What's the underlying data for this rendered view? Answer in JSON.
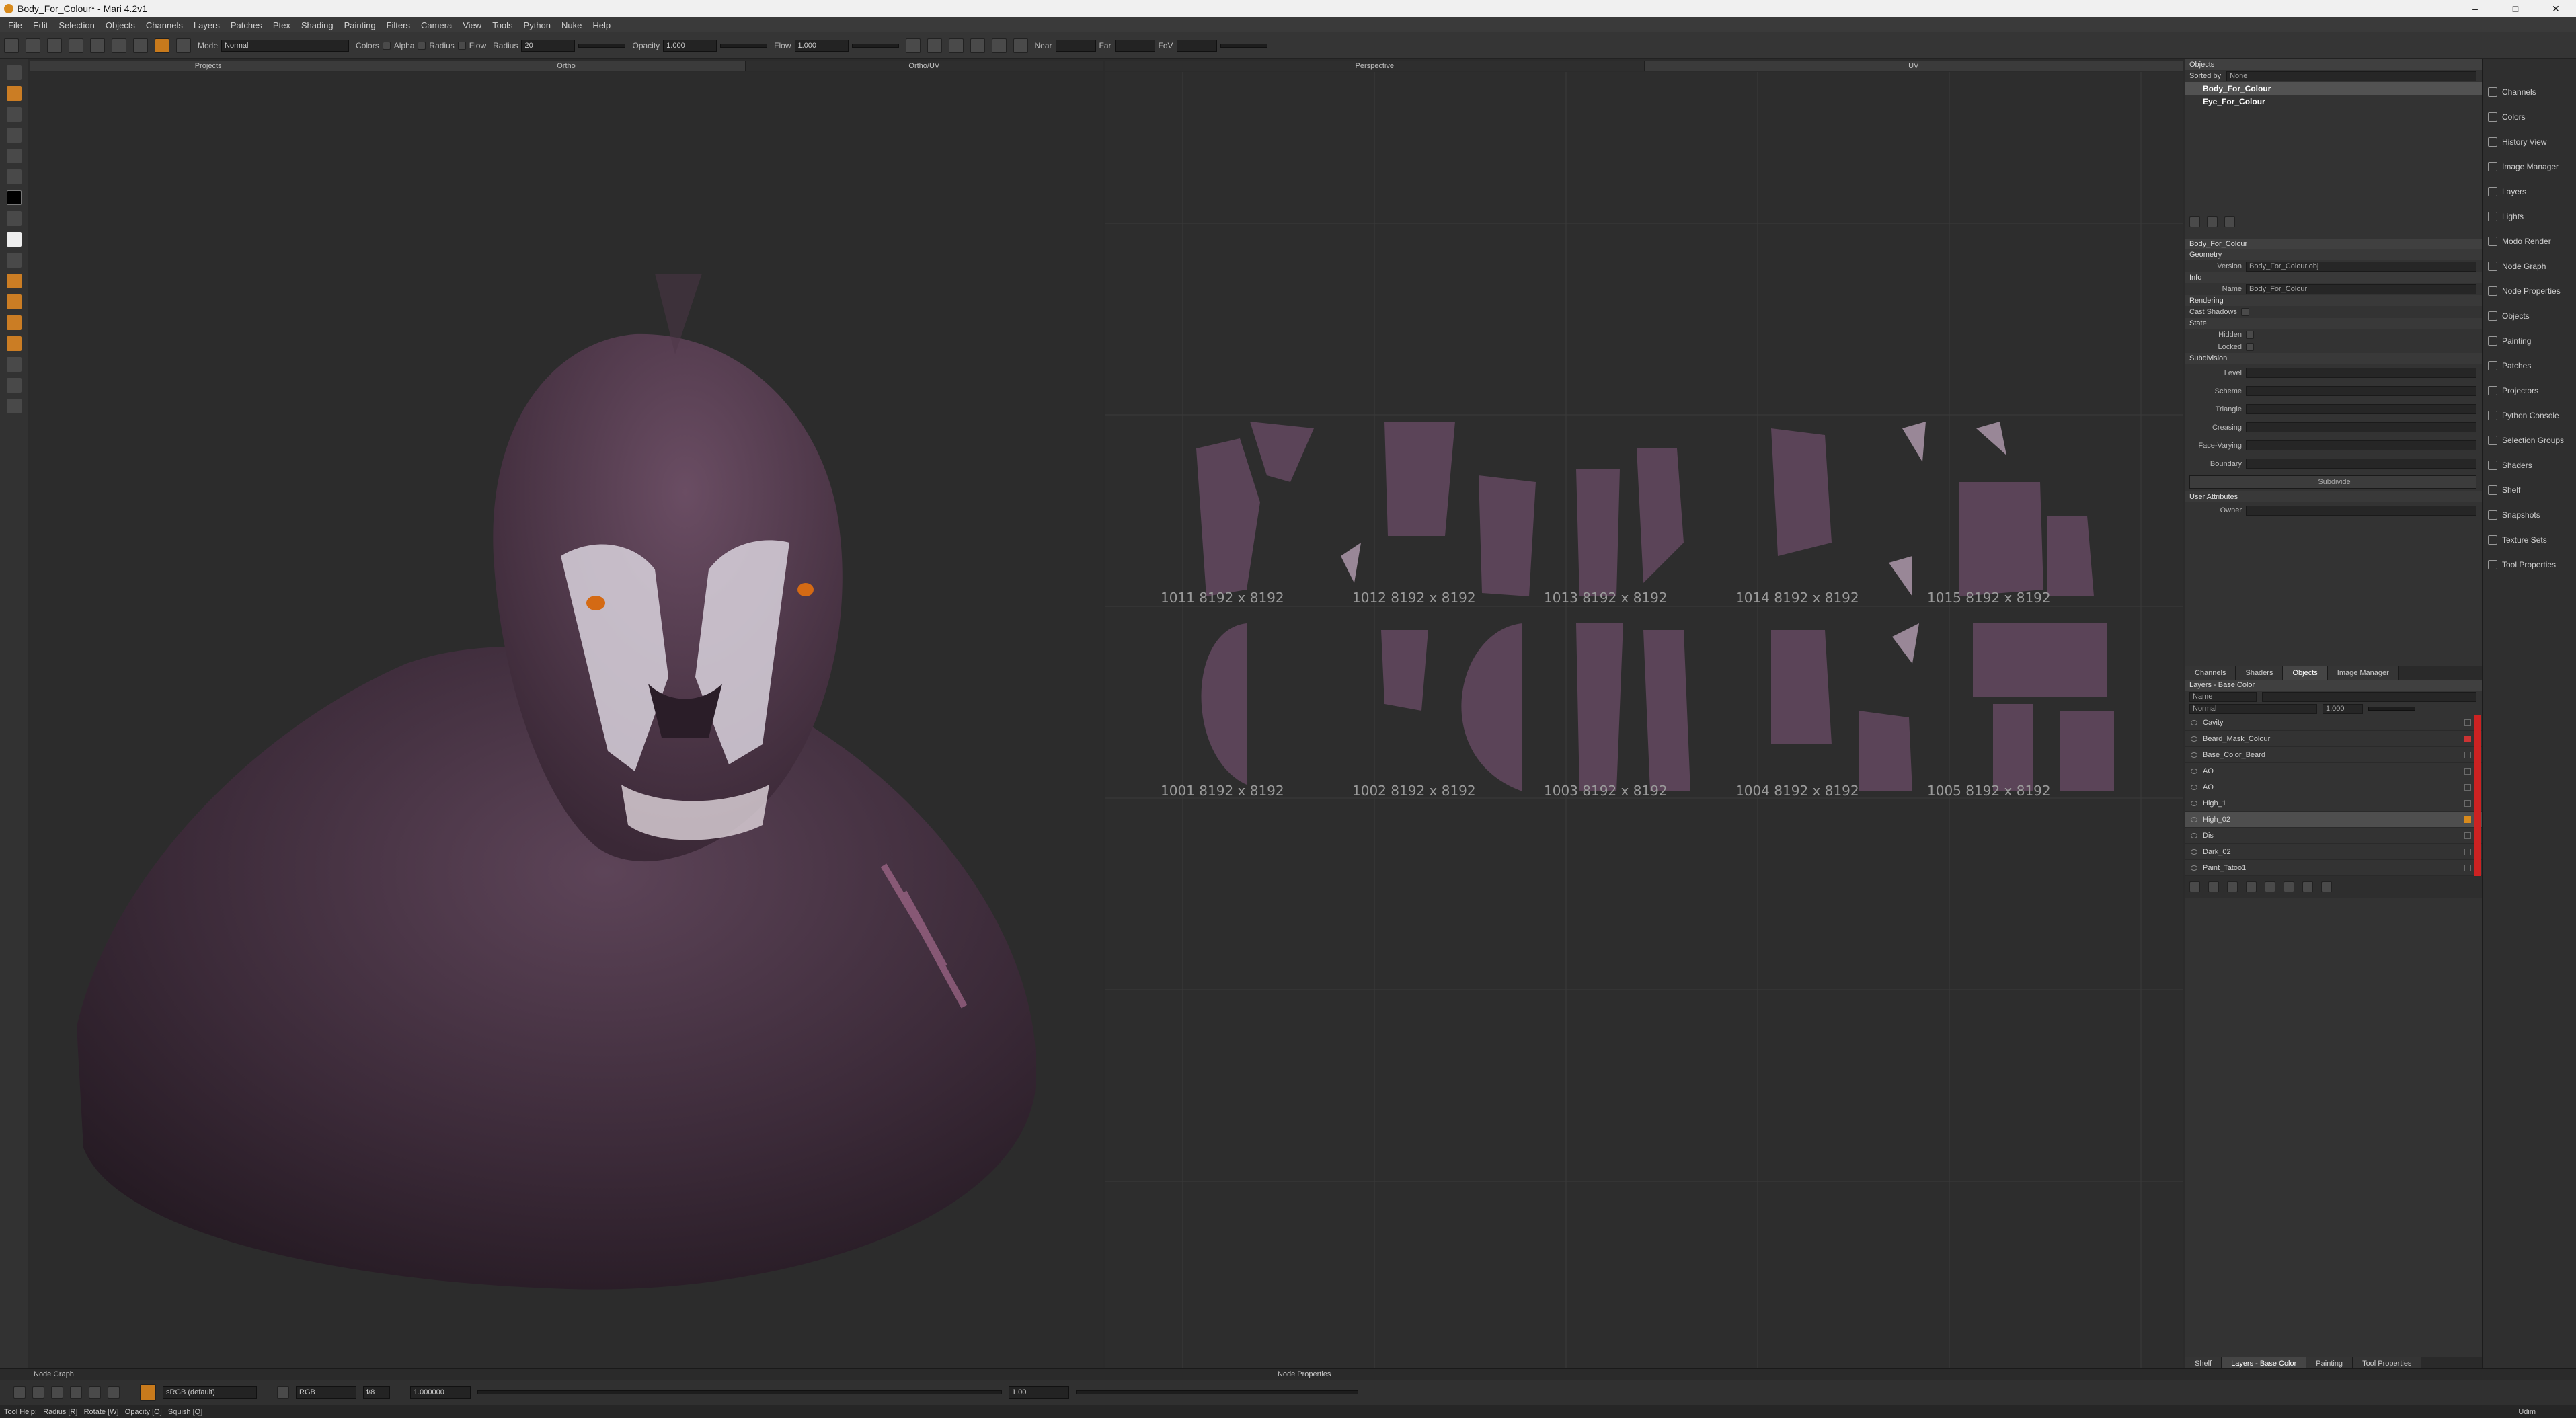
{
  "window": {
    "title": "Body_For_Colour* - Mari 4.2v1",
    "controls": [
      "–",
      "□",
      "✕"
    ]
  },
  "menu": [
    "File",
    "Edit",
    "Selection",
    "Objects",
    "Channels",
    "Layers",
    "Patches",
    "Ptex",
    "Shading",
    "Painting",
    "Filters",
    "Camera",
    "View",
    "Tools",
    "Python",
    "Nuke",
    "Help"
  ],
  "toolbar": {
    "mode_label": "Mode",
    "mode_value": "Normal",
    "colors_label": "Colors",
    "alpha_label": "Alpha",
    "radius_toggle_label": "Radius",
    "flow_toggle_label": "Flow",
    "radius_label": "Radius",
    "radius_value": "20",
    "opacity_label": "Opacity",
    "opacity_value": "1.000",
    "flow_label": "Flow",
    "flow_value": "1.000",
    "near_label": "Near",
    "far_label": "Far",
    "fov_label": "FoV"
  },
  "left_tabs": [
    "Projects",
    "Ortho",
    "Ortho/UV"
  ],
  "right_tabs": [
    "Perspective",
    "UV"
  ],
  "uv_tiles_top": [
    {
      "id": "1011",
      "size": "8192 x 8192"
    },
    {
      "id": "1012",
      "size": "8192 x 8192"
    },
    {
      "id": "1013",
      "size": "8192 x 8192"
    },
    {
      "id": "1014",
      "size": "8192 x 8192"
    },
    {
      "id": "1015",
      "size": "8192 x 8192"
    }
  ],
  "uv_tiles_bottom": [
    {
      "id": "1001",
      "size": "8192 x 8192"
    },
    {
      "id": "1002",
      "size": "8192 x 8192"
    },
    {
      "id": "1003",
      "size": "8192 x 8192"
    },
    {
      "id": "1004",
      "size": "8192 x 8192"
    },
    {
      "id": "1005",
      "size": "8192 x 8192"
    }
  ],
  "objects_panel": {
    "title": "Objects",
    "sorted_by_label": "Sorted by",
    "sorted_by_value": "None",
    "items": [
      "Body_For_Colour",
      "Eye_For_Colour"
    ]
  },
  "properties": {
    "header": "Body_For_Colour",
    "geometry_label": "Geometry",
    "version_label": "Version",
    "version_value": "Body_For_Colour.obj",
    "info_label": "Info",
    "name_label": "Name",
    "name_value": "Body_For_Colour",
    "rendering_label": "Rendering",
    "cast_shadows_label": "Cast Shadows",
    "state_label": "State",
    "hidden_label": "Hidden",
    "locked_label": "Locked",
    "subdivision_label": "Subdivision",
    "level_label": "Level",
    "scheme_label": "Scheme",
    "triangle_label": "Triangle",
    "creasing_label": "Creasing",
    "face_varying_label": "Face-Varying",
    "boundary_label": "Boundary",
    "subdivide_label": "Subdivide",
    "user_attributes_label": "User Attributes",
    "owner_label": "Owner"
  },
  "lower_tabs": [
    "Channels",
    "Shaders",
    "Objects",
    "Image Manager"
  ],
  "layers_panel": {
    "title": "Layers - Base Color",
    "filter_value": "Name",
    "blend_mode": "Normal",
    "opacity": "1.000",
    "rows": [
      "Cavity",
      "Beard_Mask_Colour",
      "Base_Color_Beard",
      "AO",
      "AO",
      "High_1",
      "High_02",
      "Dis",
      "Dark_02",
      "Paint_Tatoo1"
    ]
  },
  "bottom_right_tabs": [
    "Shelf",
    "Layers - Base Color",
    "Painting",
    "Tool Properties"
  ],
  "right_dock": [
    "Channels",
    "Colors",
    "History View",
    "Image Manager",
    "Layers",
    "Lights",
    "Modo Render",
    "Node Graph",
    "Node Properties",
    "Objects",
    "Painting",
    "Patches",
    "Projectors",
    "Python Console",
    "Selection Groups",
    "Shaders",
    "Shelf",
    "Snapshots",
    "Texture Sets",
    "Tool Properties"
  ],
  "bottom": {
    "node_graph_label": "Node Graph",
    "node_properties_label": "Node Properties",
    "colorspace_value": "sRGB (default)",
    "channel_value": "RGB",
    "fstop_value": "f/8",
    "gain_value": "1.000000",
    "gamma_value": "1.00",
    "status_help": "Tool Help:   Radius [R]   Rotate [W]   Opacity [O]   Squish [Q]",
    "status_right": "Udim"
  },
  "colors": {
    "accent": "#d88a1c",
    "skin": "#5a3f55",
    "red_marker": "#cc2222"
  }
}
